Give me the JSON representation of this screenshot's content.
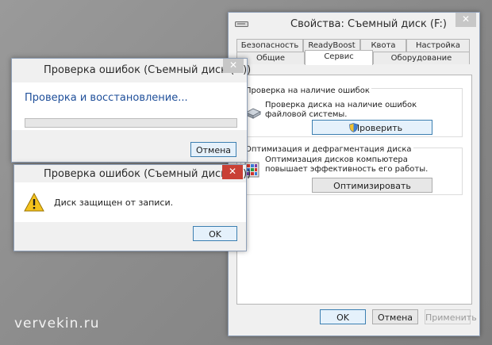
{
  "properties_window": {
    "title": "Свойства: Съемный диск (F:)",
    "tabs_back": [
      "Безопасность",
      "ReadyBoost",
      "Квота",
      "Настройка"
    ],
    "tabs_front": [
      "Общие",
      "Сервис",
      "Оборудование"
    ],
    "active_tab": "Сервис",
    "error_check_group": {
      "title": "Проверка на наличие ошибок",
      "description": "Проверка диска на наличие ошибок файловой системы.",
      "button_label": "Проверить"
    },
    "optimize_group": {
      "title": "Оптимизация и дефрагментация диска",
      "description": "Оптимизация дисков компьютера повышает эффективность его работы.",
      "button_label": "Оптимизировать"
    },
    "ok_label": "OK",
    "cancel_label": "Отмена",
    "apply_label": "Применить"
  },
  "check_window": {
    "title": "Проверка ошибок (Съемный диск (F:))",
    "heading": "Проверка и восстановление...",
    "progress": 0,
    "cancel_label": "Отмена"
  },
  "error_window": {
    "title": "Проверка ошибок (Съемный диск (F:))",
    "message": "Диск защищен от записи.",
    "ok_label": "OK",
    "icon": "warning-icon"
  },
  "watermark": "vervekin.ru",
  "colors": {
    "accent": "#1f4f9a",
    "close_red": "#c94035",
    "progress": "#06b025"
  }
}
